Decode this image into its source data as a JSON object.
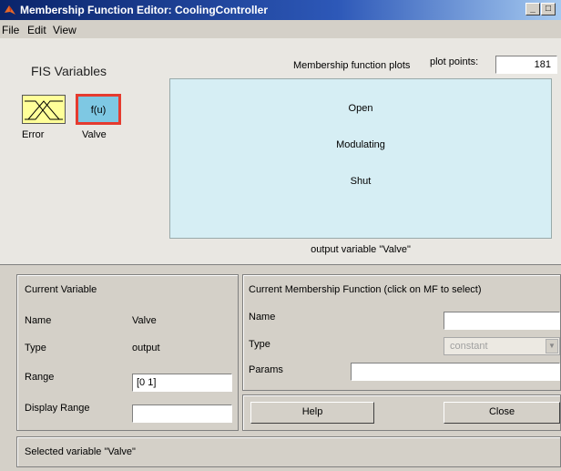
{
  "window": {
    "title": "Membership Function Editor: CoolingController",
    "minimize_label": "_",
    "maximize_label": "□"
  },
  "menu": [
    "File",
    "Edit",
    "View"
  ],
  "fis": {
    "title": "FIS Variables",
    "input_name": "Error",
    "output_name": "Valve",
    "output_box_label": "f(u)"
  },
  "plot": {
    "header": "Membership function plots",
    "points_label": "plot points:",
    "points_value": "181",
    "mf_labels": [
      "Open",
      "Modulating",
      "Shut"
    ],
    "caption": "output variable \"Valve\""
  },
  "current_variable": {
    "title": "Current Variable",
    "name_label": "Name",
    "name_value": "Valve",
    "type_label": "Type",
    "type_value": "output",
    "range_label": "Range",
    "range_value": "[0 1]",
    "display_range_label": "Display Range",
    "display_range_value": ""
  },
  "current_mf": {
    "title": "Current Membership Function (click on MF to select)",
    "name_label": "Name",
    "name_value": "",
    "type_label": "Type",
    "type_value": "constant",
    "params_label": "Params",
    "params_value": ""
  },
  "buttons": {
    "help": "Help",
    "close": "Close"
  },
  "status": "Selected variable \"Valve\"",
  "colors": {
    "input_box": "#ffff99",
    "output_box": "#7ec8e3",
    "selection_border": "#e53b2f",
    "plot_background": "#d6eef4"
  }
}
